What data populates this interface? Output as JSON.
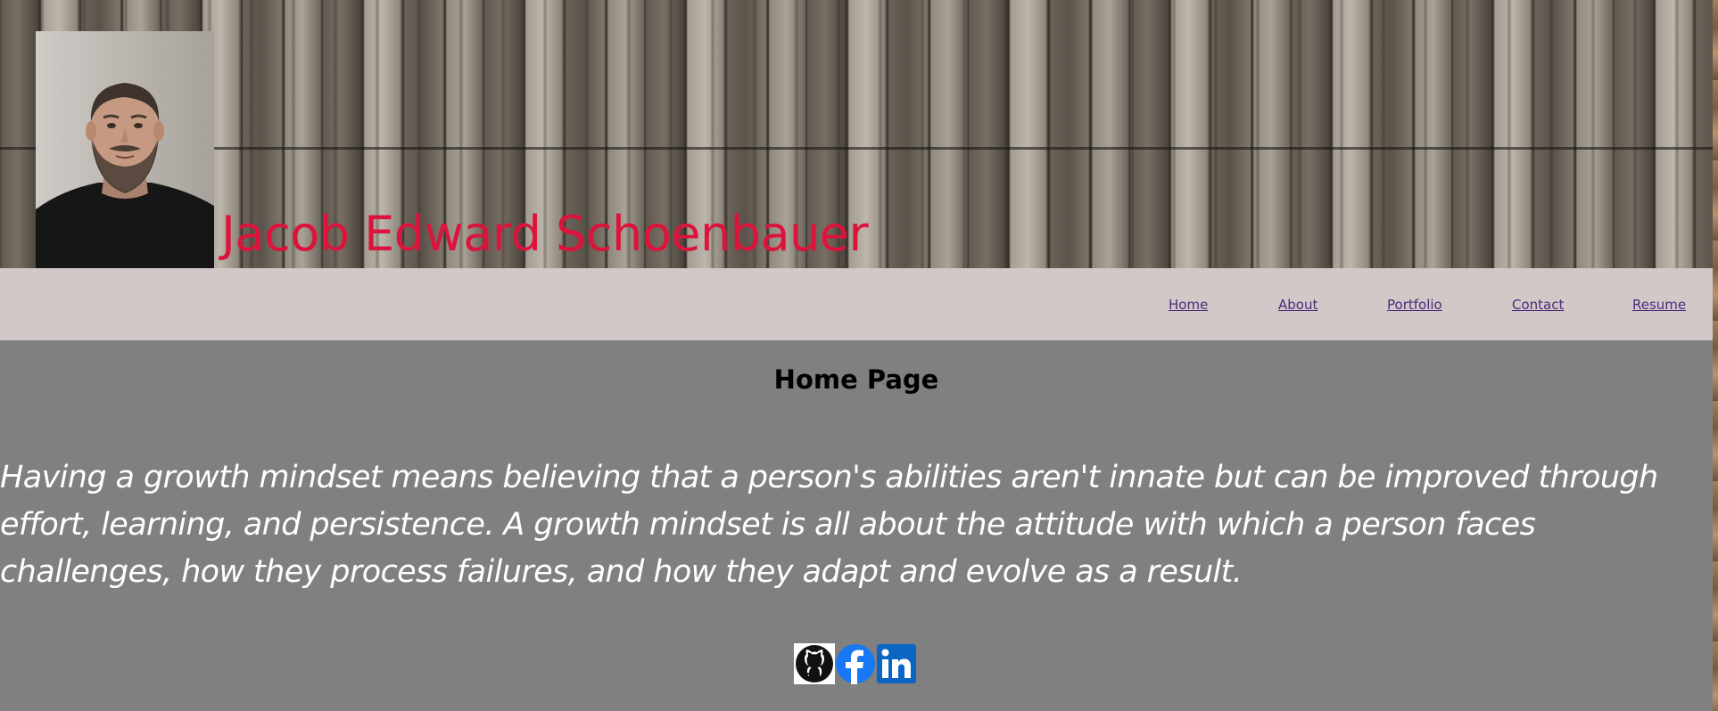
{
  "header": {
    "site_name": "Jacob Edward Schoenbauer",
    "photo_icon": "profile-photo",
    "name_color": "#dc143c"
  },
  "nav": {
    "items": [
      {
        "label": "Home"
      },
      {
        "label": "About"
      },
      {
        "label": "Portfolio"
      },
      {
        "label": "Contact"
      },
      {
        "label": "Resume"
      }
    ],
    "link_color": "#4b2c7a",
    "background": "#d2c8c8"
  },
  "main": {
    "title": "Home Page",
    "quote": "Having a growth mindset means believing that a person's abilities aren't innate but can be improved through effort, learning, and persistence. A growth mindset is all about the attitude with which a person faces challenges, how they process failures, and how they adapt and evolve as a result.",
    "background": "#808080"
  },
  "social": {
    "icons": [
      "github-icon",
      "facebook-icon",
      "linkedin-icon"
    ],
    "facebook_color": "#1877f2",
    "linkedin_color": "#0a66c2"
  }
}
